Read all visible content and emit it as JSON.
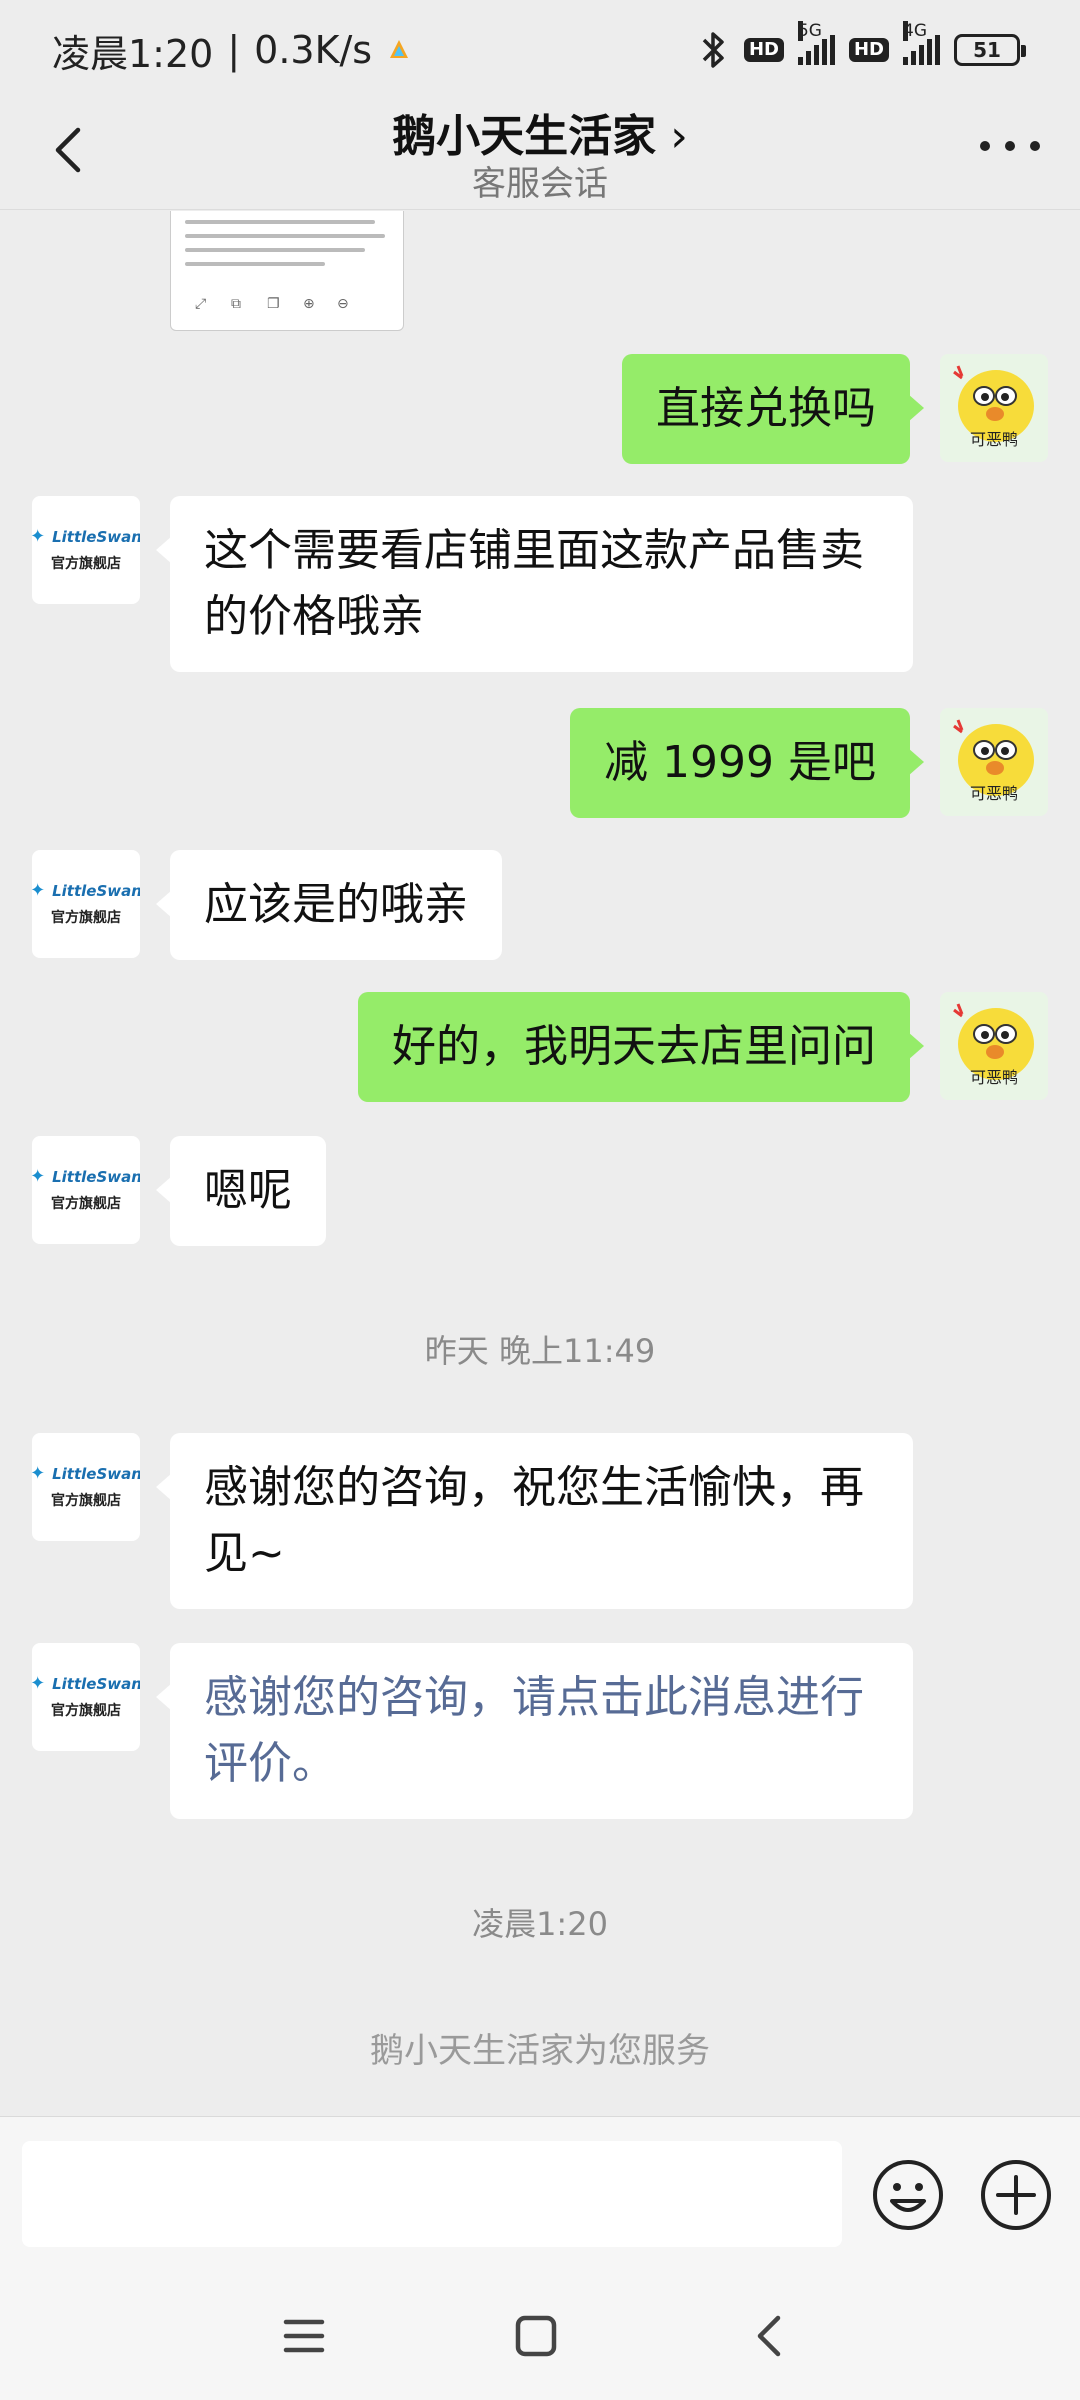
{
  "status_bar": {
    "time": "凌晨1:20",
    "separator": "|",
    "speed": "0.3K/s",
    "hd_badge": "HD",
    "net_5g": "5G",
    "net_4g": "4G",
    "battery": "51"
  },
  "header": {
    "title": "鹅小天生活家",
    "subtitle": "客服会话",
    "chevron": "›"
  },
  "avatars": {
    "shop_brand": "LittleSwan",
    "shop_label": "官方旗舰店",
    "user_caption": "可恶鸭"
  },
  "messages": [
    {
      "side": "out",
      "text": "直接兑换吗"
    },
    {
      "side": "in",
      "text": "这个需要看店铺里面这款产品售卖的价格哦亲"
    },
    {
      "side": "out",
      "text": "减 1999 是吧"
    },
    {
      "side": "in",
      "text": "应该是的哦亲"
    },
    {
      "side": "out",
      "text": "好的，我明天去店里问问"
    },
    {
      "side": "in",
      "text": "嗯呢"
    },
    {
      "side": "in",
      "text": "感谢您的咨询，祝您生活愉快，再见~"
    },
    {
      "side": "in",
      "text": "感谢您的咨询，请点击此消息进行评价。"
    }
  ],
  "timestamps": {
    "yesterday": "昨天 晚上11:49",
    "now": "凌晨1:20"
  },
  "service_note": "鹅小天生活家为您服务",
  "colors": {
    "background": "#ededed",
    "outgoing_bubble": "#95ec69",
    "incoming_bubble": "#ffffff",
    "link_text": "#576b95"
  },
  "icons": {
    "back": "back-arrow-icon",
    "more": "more-dots-icon",
    "emoji": "smiley-icon",
    "plus": "plus-circle-icon",
    "bluetooth": "bluetooth-icon"
  }
}
